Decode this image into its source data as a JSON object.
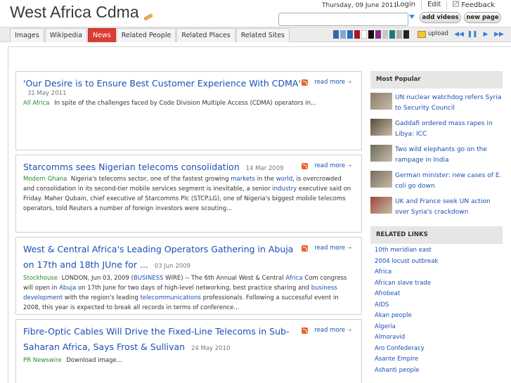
{
  "header": {
    "site_title": "West Africa Cdma",
    "date": "Thursday, 09 June 2011",
    "top_links": [
      "Login",
      "Edit",
      "Feedback"
    ],
    "add_videos": "add videos",
    "new_page": "new page"
  },
  "nav": {
    "tabs": [
      "Images",
      "Wikipedia",
      "News",
      "Related People",
      "Related Places",
      "Related Sites"
    ],
    "active_tab": "News",
    "swatches": [
      "#3a66a8",
      "#7fa8d8",
      "#2a6bb8",
      "#a8171e",
      "#ffffff",
      "#111111",
      "#8a2a8a",
      "#c8c8c8",
      "#1a7a80",
      "#b0b0b0",
      "#222222"
    ],
    "upload": "upload"
  },
  "articles": [
    {
      "title": "'Our Desire is to Ensure Best Customer Experience With CDMA'",
      "date": "31 May 2011",
      "source": "All Africa",
      "body": "In spite of the challenges faced by Code Division Multiple Access (CDMA) operators in...",
      "read_more": "read more"
    },
    {
      "title": "Starcomms sees Nigerian telecoms consolidation",
      "date": "14 Mar 2009",
      "source": "Modern Ghana",
      "body_1": "Nigeria's telecoms sector, one of the fastest growing ",
      "link_1": "markets",
      "body_2": " in the ",
      "link_2": "world",
      "body_3": ", is overcrowded and consolidation in its second-tier mobile services segment is inevitable, a senior ",
      "link_3": "industry",
      "body_4": " executive said on Friday. Maher Qubain, chief executive of Starcomms Plc (STCP.LG), one of Nigeria's biggest mobile telecoms operators, told Reuters a number of foreign investors were scouting...",
      "read_more": "read more"
    },
    {
      "title": "West & Central Africa's Leading Operators Gathering in Abuja on 17th and 18th JUne for ...",
      "date": "03 Jun 2009",
      "source": "Stockhouse",
      "body_1": "LONDON, Jun 03, 2009 (",
      "link_1": "BUSINESS",
      "body_2": " WIRE) -- The 6th Annual West & Central ",
      "link_2": "Africa",
      "body_3": " Com congress will open in ",
      "link_3": "Abuja",
      "body_4": " on 17th June for two days of high-level networking, best practice sharing and ",
      "link_4": "business development",
      "body_5": " with the region's leading ",
      "link_5": "telecommunications",
      "body_6": " professionals. Following a successful event in 2008, this year is expected to break all records in terms of conference...",
      "read_more": "read more"
    },
    {
      "title": "Fibre-Optic Cables Will Drive the Fixed-Line Telecoms in Sub-Saharan Africa, Says Frost & Sullivan",
      "date": "24 May 2010",
      "source": "PR Newswire",
      "body": "Download image...",
      "read_more": "read more"
    }
  ],
  "sidebar": {
    "most_popular_title": "Most Popular",
    "most_popular": [
      {
        "text": "UN nuclear watchdog refers Syria to Security Council",
        "color": "#8a7a6a"
      },
      {
        "text": "Gaddafi ordered mass rapes in Libya: ICC",
        "color": "#5a4a3a"
      },
      {
        "text": "Two wild elephants go on the rampage in India",
        "color": "#6a6a5a"
      },
      {
        "text": "German minister: new cases of E. coli go down",
        "color": "#7a6a5a"
      },
      {
        "text": "UK and France seek UN action over Syria's crackdown",
        "color": "#9a4a3a"
      }
    ],
    "related_links_title": "RELATED LINKS",
    "related_links": [
      "10th meridian east",
      "2004 locust outbreak",
      "Africa",
      "African slave trade",
      "Afrobeat",
      "AIDS",
      "Akan people",
      "Algeria",
      "Almoravid",
      "Aro Confederacy",
      "Asante Empire",
      "Ashanti people"
    ]
  }
}
